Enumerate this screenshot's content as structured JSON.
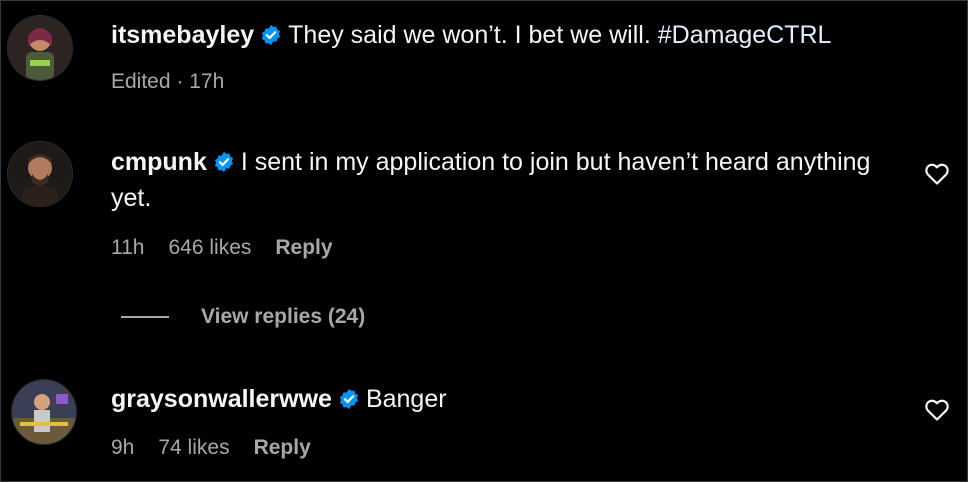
{
  "comments": [
    {
      "username": "itsmebayley",
      "text": "They said we won’t. I bet we will.",
      "hashtag": "#DamageCTRL",
      "meta": {
        "edited": "Edited · 17h"
      }
    },
    {
      "username": "cmpunk",
      "text": "I sent in my application to join but haven’t heard anything yet.",
      "meta": {
        "time": "11h",
        "likes": "646 likes",
        "reply": "Reply"
      },
      "view_replies": "View replies (24)"
    },
    {
      "username": "graysonwallerwwe",
      "text": "Banger",
      "meta": {
        "time": "9h",
        "likes": "74 likes",
        "reply": "Reply"
      }
    }
  ],
  "icons": {
    "verified": "verified-badge-icon",
    "like": "heart-outline-icon"
  },
  "colors": {
    "background": "#000000",
    "text": "#f5f5f5",
    "muted": "#a8a8a8",
    "verified": "#0095f6"
  }
}
